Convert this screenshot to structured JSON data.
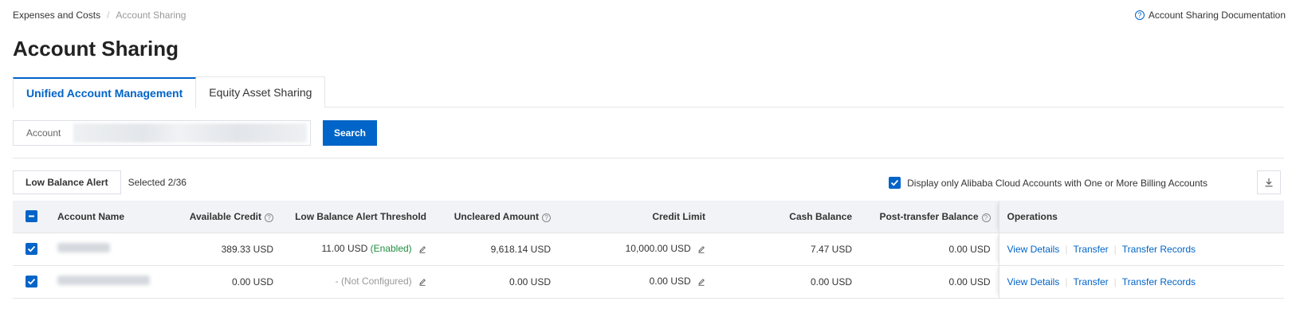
{
  "breadcrumb": {
    "root": "Expenses and Costs",
    "separator": "/",
    "current": "Account Sharing"
  },
  "doc_link": {
    "icon": "question-circle-icon",
    "label": "Account Sharing Documentation"
  },
  "title": "Account Sharing",
  "tabs": [
    {
      "label": "Unified Account Management",
      "active": true
    },
    {
      "label": "Equity Asset Sharing",
      "active": false
    }
  ],
  "search": {
    "label": "Account",
    "value": "",
    "button": "Search"
  },
  "toolbar": {
    "low_balance_button": "Low Balance Alert",
    "selected": "Selected 2/36",
    "display_only_label": "Display only Alibaba Cloud Accounts with One or More Billing Accounts",
    "display_only_checked": true,
    "download_icon": "download-icon"
  },
  "table": {
    "headers": {
      "account_name": "Account Name",
      "available_credit": "Available Credit",
      "threshold": "Low Balance Alert Threshold",
      "uncleared": "Uncleared Amount",
      "credit_limit": "Credit Limit",
      "cash_balance": "Cash Balance",
      "post_transfer": "Post-transfer Balance",
      "operations": "Operations"
    },
    "rows": [
      {
        "checked": true,
        "account_name": "",
        "available_credit": "389.33 USD",
        "threshold_value": "11.00 USD",
        "threshold_status": "(Enabled)",
        "uncleared": "9,618.14 USD",
        "credit_limit": "10,000.00 USD",
        "cash_balance": "7.47 USD",
        "post_transfer": "0.00 USD",
        "ops": [
          "View Details",
          "Transfer",
          "Transfer Records"
        ]
      },
      {
        "checked": true,
        "account_name": "",
        "available_credit": "0.00 USD",
        "threshold_value": "- (Not Configured)",
        "threshold_status": "",
        "uncleared": "0.00 USD",
        "credit_limit": "0.00 USD",
        "cash_balance": "0.00 USD",
        "post_transfer": "0.00 USD",
        "ops": [
          "View Details",
          "Transfer",
          "Transfer Records"
        ]
      }
    ]
  },
  "colors": {
    "accent": "#0064c8",
    "enabled": "#1e8e3e",
    "header_bg": "#f1f3f6"
  }
}
